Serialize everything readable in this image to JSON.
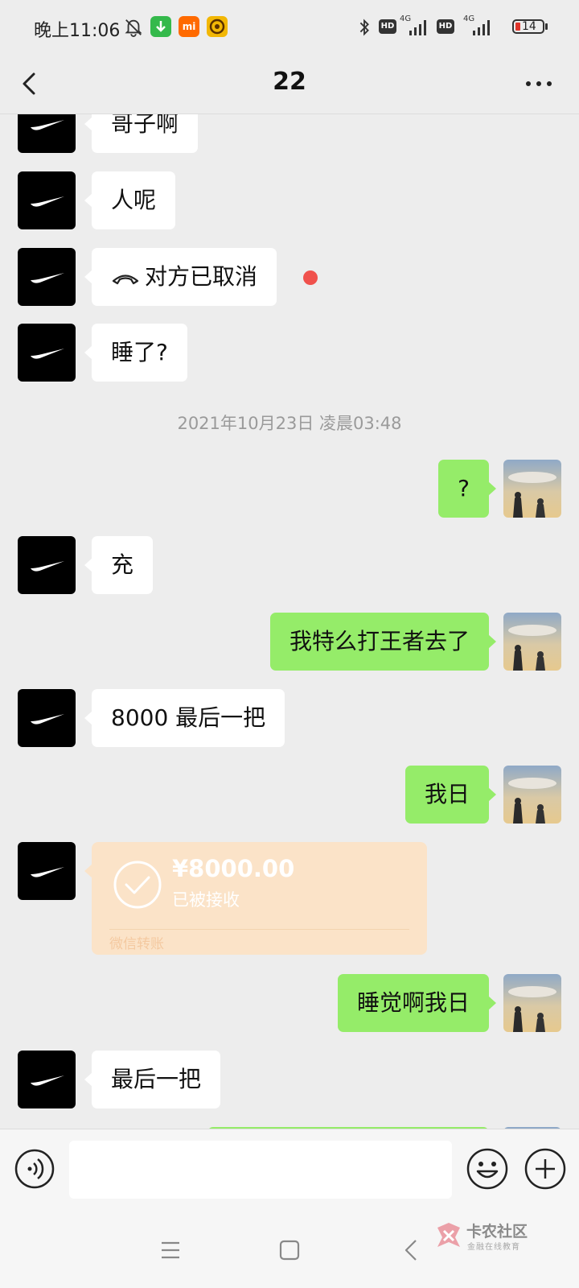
{
  "status_bar": {
    "time": "晚上11:06",
    "signal_label_1": "4G",
    "signal_label_2": "4G",
    "hd_label": "HD",
    "battery": "14",
    "mi_label": "mi"
  },
  "nav": {
    "title": "22",
    "back_icon": "chevron-left-icon",
    "more_icon": "more-dots-icon"
  },
  "messages": [
    {
      "side": "left",
      "text": "哥子啊"
    },
    {
      "side": "left",
      "text": "人呢"
    },
    {
      "side": "left",
      "text": "对方已取消",
      "icon": "phone-hangup-icon",
      "unread_dot": true
    },
    {
      "side": "left",
      "text": "睡了?"
    },
    {
      "type": "time",
      "text": "2021年10月23日 凌晨03:48"
    },
    {
      "side": "right",
      "text": "?"
    },
    {
      "side": "left",
      "text": "充"
    },
    {
      "side": "right",
      "text": "我特么打王者去了"
    },
    {
      "side": "left",
      "text": "8000 最后一把"
    },
    {
      "side": "right",
      "text": "我日"
    },
    {
      "side": "left",
      "type": "transfer",
      "amount": "¥8000.00",
      "status": "已被接收",
      "label": "微信转账"
    },
    {
      "side": "right",
      "text": "睡觉啊我日"
    },
    {
      "side": "left",
      "text": "最后一把"
    }
  ],
  "input_bar": {
    "placeholder": "",
    "voice_icon": "voice-icon",
    "emoji_icon": "emoji-icon",
    "plus_icon": "plus-icon"
  },
  "watermark": {
    "title": "卡农社区",
    "subtitle": "金融在线教育"
  },
  "colors": {
    "background": "#ededed",
    "sent_bubble": "#95ec69",
    "received_bubble": "#ffffff",
    "transfer_card": "#fbe3c8",
    "unread_dot": "#f0514c"
  }
}
